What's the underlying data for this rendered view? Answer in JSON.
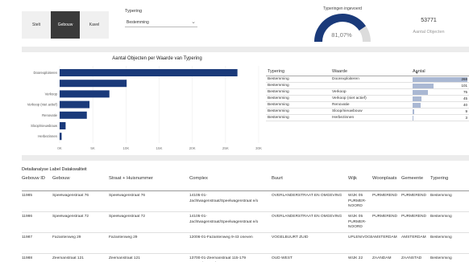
{
  "toolbar": {
    "segments": [
      {
        "label": "Stelt",
        "active": false
      },
      {
        "label": "Gebouw",
        "active": true
      },
      {
        "label": "Kavel",
        "active": false
      }
    ],
    "filter_label": "Typering",
    "filter_value": "Bestemming"
  },
  "gauge": {
    "title": "Typeringen ingevoerd",
    "percent_label": "81,07%",
    "value": 0.8107,
    "color": "#1a3a7a"
  },
  "kpi": {
    "value": "53771",
    "label": "Aantal Objecten"
  },
  "chart_data": {
    "type": "bar",
    "title": "Aantal Objecten per Waarde van Typering",
    "categories": [
      "Doorexploiteren",
      "",
      "Verkoop",
      "Verkoop (niet actief)",
      "Renovatie",
      "Sloop/nieuwbouw",
      "Herbezinnen"
    ],
    "values": [
      26800,
      10100,
      7500,
      4500,
      4100,
      900,
      300
    ],
    "xticks": [
      "0K",
      "5K",
      "10K",
      "15K",
      "20K",
      "25K",
      "30K"
    ],
    "xlim": [
      0,
      30000
    ],
    "color": "#1a3a7a"
  },
  "summary_table": {
    "headers": [
      "Typering",
      "Waarde",
      "Aantal"
    ],
    "max": 26800,
    "rows": [
      {
        "typering": "Bestemming",
        "waarde": "Doorexploiteren",
        "aantal": "268",
        "value": 26800
      },
      {
        "typering": "Bestemming",
        "waarde": "",
        "aantal": "101",
        "value": 10100
      },
      {
        "typering": "Bestemming",
        "waarde": "Verkoop",
        "aantal": "75",
        "value": 7500
      },
      {
        "typering": "Bestemming",
        "waarde": "Verkoop (niet actief)",
        "aantal": "45",
        "value": 4500
      },
      {
        "typering": "Bestemming",
        "waarde": "Renovatie",
        "aantal": "40",
        "value": 4000
      },
      {
        "typering": "Bestemming",
        "waarde": "Sloop/nieuwbouw",
        "aantal": "9",
        "value": 900
      },
      {
        "typering": "Bestemming",
        "waarde": "Herbezinnen",
        "aantal": "3",
        "value": 300
      }
    ]
  },
  "detail": {
    "title": "Detailanalyse Label Datakwaliteit",
    "headers": [
      "Gebouw ID",
      "Gebouw",
      "Straat + Huisnummer",
      "Complex",
      "Buurt",
      "Wijk",
      "Woonplaats",
      "Gemeente",
      "Typering"
    ],
    "rows": [
      [
        "11985",
        "Speelwagenstraat 76",
        "Speelwagenstraat 76",
        "14105-01-Jachtwagenstraat/Speelwagenstraat e/o",
        "OVERLANDERSTRAAT EN OMGEVING",
        "WIJK 05 PURMER-NOORD",
        "PURMEREND",
        "PURMEREND",
        "Bestemming"
      ],
      [
        "11986",
        "Speelwagenstraat 72",
        "Speelwagenstraat 72",
        "14105-01-Jachtwagenstraat/Speelwagenstraat e/o",
        "OVERLANDERSTRAAT EN OMGEVING",
        "WIJK 05 PURMER-NOORD",
        "PURMEREND",
        "PURMEREND",
        "Bestemming"
      ],
      [
        "11987",
        "Fazantenweg 29",
        "Fazantenweg 29",
        "12006-01-Fazantenweg 9-43 oneven",
        "VOGELBUURT ZUID",
        "UPLEN/VOGELBUURT",
        "AMSTERDAM",
        "AMSTERDAM",
        "Bestemming"
      ],
      [
        "11988",
        "Zeemanstraat 121",
        "Zeemanstraat 121",
        "13700-01-Zeemanstraat 115-179 oneven/Rustenburg 104-108 even",
        "OUD WEST",
        "WIJK 22 ZAANDAM",
        "ZAANDAM",
        "ZAANSTAD",
        "Bestemming"
      ]
    ]
  }
}
